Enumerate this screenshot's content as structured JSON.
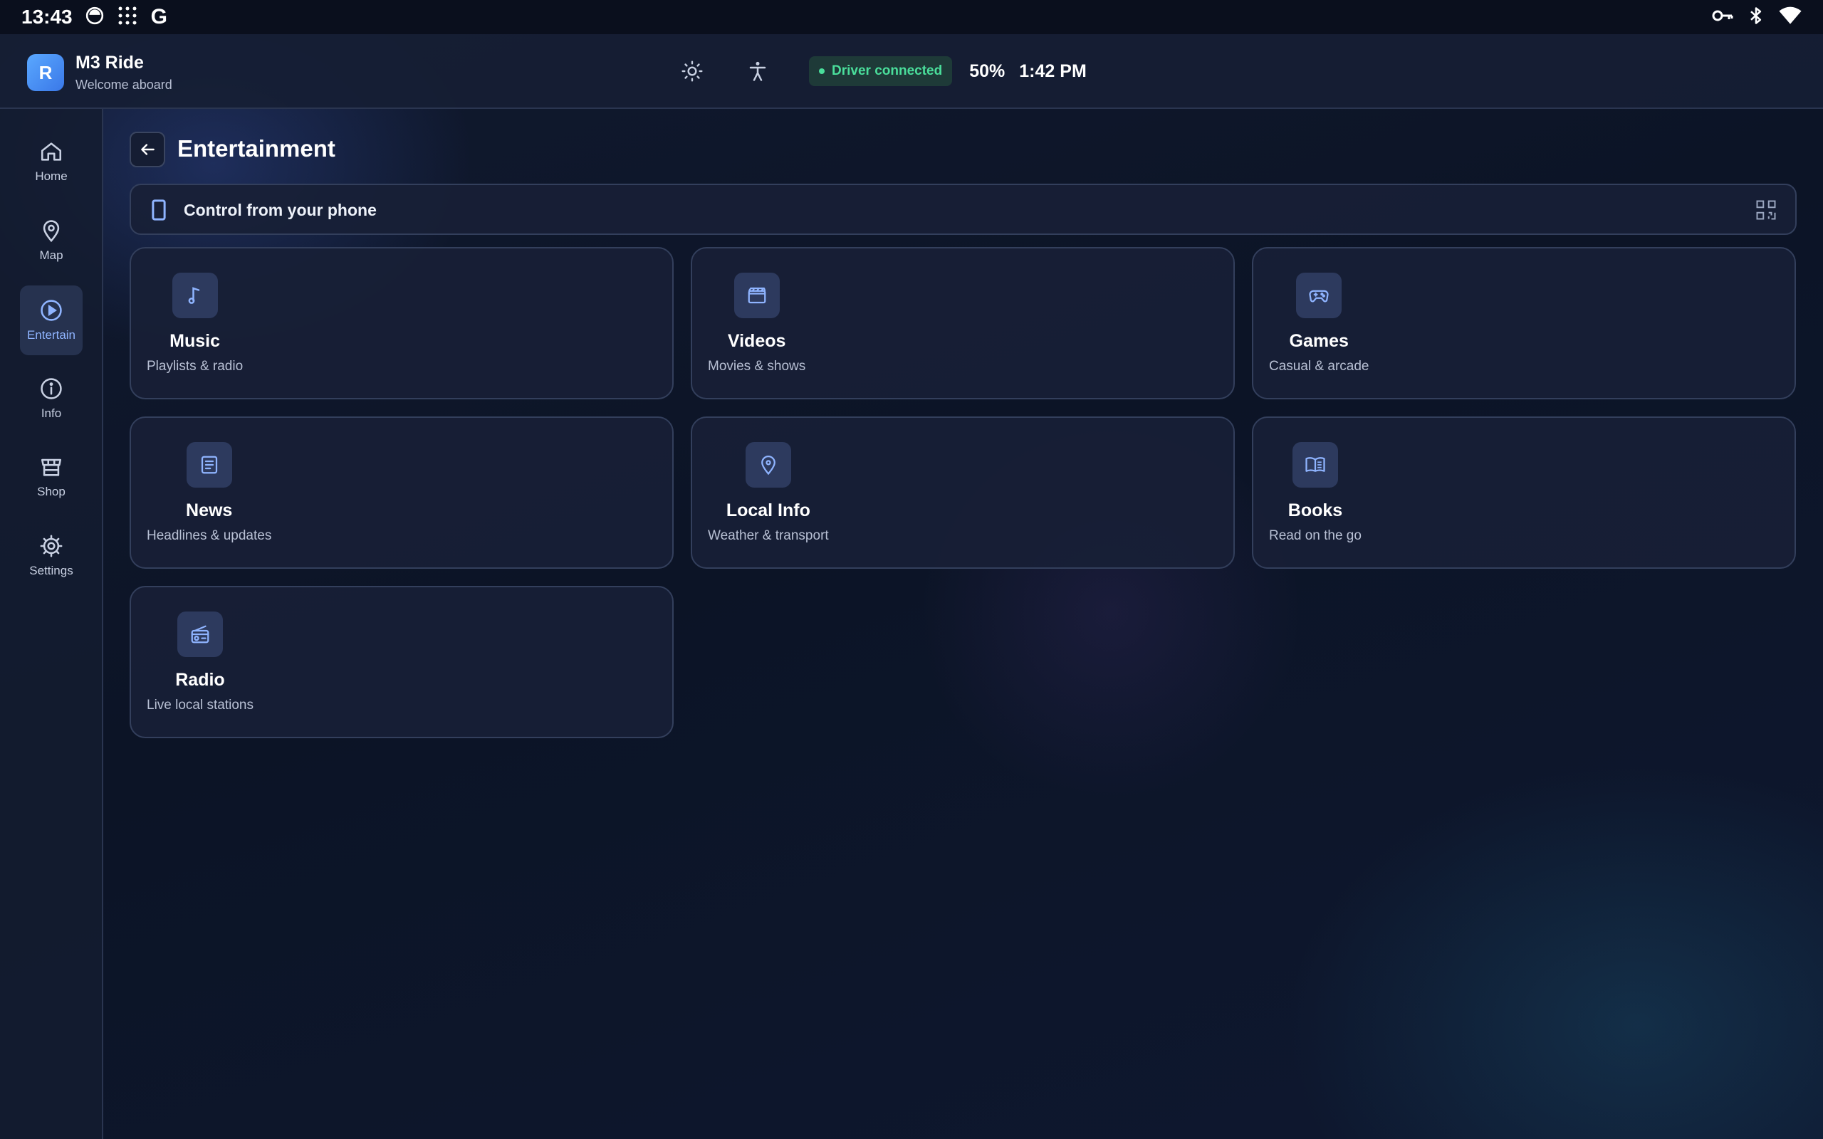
{
  "status_bar": {
    "time": "13:43",
    "icons": [
      "circle-status-icon",
      "dots-grid-icon",
      "google-icon",
      "vpn-key-icon",
      "bluetooth-icon",
      "wifi-icon"
    ],
    "google_glyph": "G"
  },
  "header": {
    "avatar_letter": "R",
    "app_title": "M3 Ride",
    "app_subtitle": "Welcome aboard",
    "driver_status": "Driver connected",
    "volume": "50%",
    "clock": "1:42 PM"
  },
  "sidebar": {
    "items": [
      {
        "label": "Home",
        "icon": "home-icon"
      },
      {
        "label": "Map",
        "icon": "map-pin-icon"
      },
      {
        "label": "Entertain",
        "icon": "play-circle-icon",
        "active": true
      },
      {
        "label": "Info",
        "icon": "info-icon"
      },
      {
        "label": "Shop",
        "icon": "store-icon"
      },
      {
        "label": "Settings",
        "icon": "gear-icon"
      }
    ]
  },
  "main": {
    "title": "Entertainment",
    "phone_bar": {
      "label": "Control from your phone"
    },
    "cards": [
      {
        "title": "Music",
        "subtitle": "Playlists & radio",
        "icon": "music-note-icon"
      },
      {
        "title": "Videos",
        "subtitle": "Movies & shows",
        "icon": "clapperboard-icon"
      },
      {
        "title": "Games",
        "subtitle": "Casual & arcade",
        "icon": "gamepad-icon"
      },
      {
        "title": "News",
        "subtitle": "Headlines & updates",
        "icon": "newspaper-icon"
      },
      {
        "title": "Local Info",
        "subtitle": "Weather & transport",
        "icon": "location-pin-icon"
      },
      {
        "title": "Books",
        "subtitle": "Read on the go",
        "icon": "open-book-icon"
      },
      {
        "title": "Radio",
        "subtitle": "Live local stations",
        "icon": "radio-icon"
      }
    ]
  },
  "colors": {
    "accent": "#8fb4ff",
    "connected": "#4ade9b",
    "card_bg": "#181f36",
    "background": "#0c1426"
  }
}
